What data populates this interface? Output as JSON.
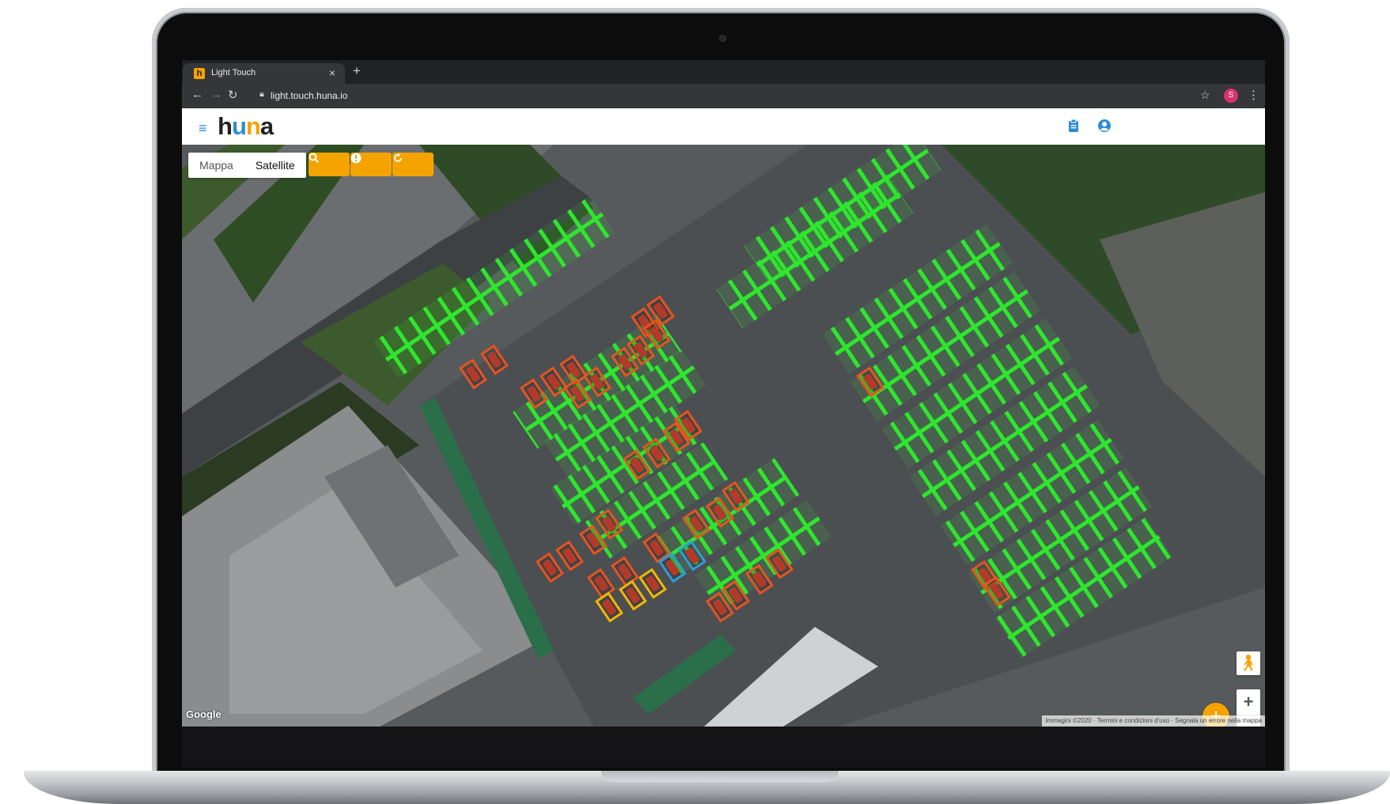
{
  "browser": {
    "tab_title": "Light Touch",
    "tab_favicon_letter": "h",
    "tab_close": "×",
    "new_tab": "+",
    "url": "light.touch.huna.io",
    "profile_initial": "S"
  },
  "app": {
    "logo_h": "h",
    "logo_u": "u",
    "logo_n": "n",
    "logo_a": "a"
  },
  "map": {
    "map_type_options": [
      "Mappa",
      "Satellite"
    ],
    "selected_map_type": "Satellite",
    "google_label": "Google",
    "attribution": "Immagini ©2020 · Termini e condizioni d'uso · Segnala un errore nella mappa",
    "zoom_in": "+",
    "zoom_out": "−",
    "fab": "+"
  },
  "colors": {
    "accent": "#f5a300",
    "brand_blue": "#2d8ccf",
    "free_spot": "#2ee62e",
    "occupied_spot": "#e8531f",
    "reserved_spot": "#2d9cdb",
    "warning_spot": "#f2b705"
  },
  "icons": {
    "search": "search-icon",
    "alert": "alert-icon",
    "refresh": "refresh-icon",
    "clipboard": "clipboard-icon",
    "account": "account-icon",
    "pegman": "pegman-icon"
  }
}
